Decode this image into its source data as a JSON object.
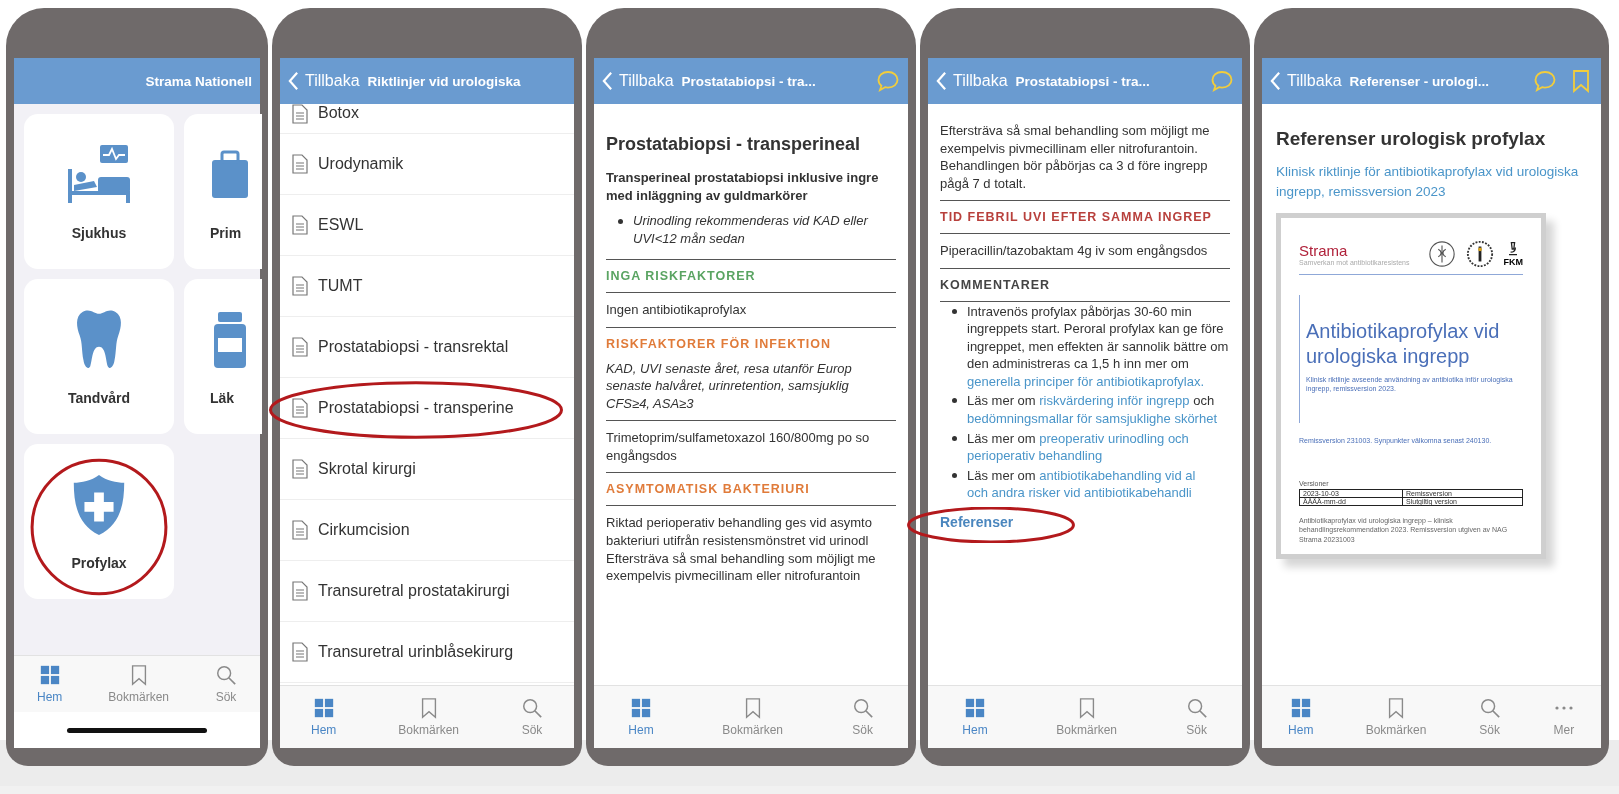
{
  "screens": [
    {
      "kind": "home",
      "header": {
        "title": "Strama Nationell"
      },
      "tiles": [
        {
          "label": "Sjukhus",
          "circled": false
        },
        {
          "label": "Prim",
          "circled": false
        },
        {
          "label": "Tandvård",
          "circled": false
        },
        {
          "label": "Läk",
          "circled": false
        },
        {
          "label": "Profylax",
          "circled": true
        }
      ],
      "tab_bar": [
        {
          "label": "Hem",
          "selected": true
        },
        {
          "label": "Bokmärken",
          "selected": false
        },
        {
          "label": "Sök",
          "selected": false
        }
      ]
    },
    {
      "kind": "list",
      "header": {
        "back": "Tillbaka",
        "title": "Riktlinjer vid urologiska"
      },
      "items": [
        {
          "label": "Botox",
          "circled": false
        },
        {
          "label": "Urodynamik",
          "circled": false
        },
        {
          "label": "ESWL",
          "circled": false
        },
        {
          "label": "TUMT",
          "circled": false
        },
        {
          "label": "Prostatabiopsi - transrektal",
          "circled": false
        },
        {
          "label": "Prostatabiopsi - transperine",
          "circled": true
        },
        {
          "label": "Skrotal kirurgi",
          "circled": false
        },
        {
          "label": "Cirkumcision",
          "circled": false
        },
        {
          "label": "Transuretral prostatakirurgi",
          "circled": false
        },
        {
          "label": "Transuretral urinblåsekirurg",
          "circled": false
        }
      ],
      "tab_bar": [
        {
          "label": "Hem",
          "selected": true
        },
        {
          "label": "Bokmärken",
          "selected": false
        },
        {
          "label": "Sök",
          "selected": false
        }
      ]
    },
    {
      "kind": "article",
      "header": {
        "back": "Tillbaka",
        "title": "Prostatabiopsi - tra..."
      },
      "blocks": [
        {
          "kind": "title",
          "text": "Prostatabiopsi - transperineal"
        },
        {
          "kind": "lead",
          "text": "Transperineal prostatabiopsi inklusive ingre med inläggning av guldmarkörer"
        },
        {
          "kind": "note",
          "text": "Urinodling rekommenderas vid KAD eller UVI<12 mån sedan"
        },
        {
          "kind": "rule"
        },
        {
          "kind": "heading",
          "text": "INGA RISKFAKTORER",
          "color": "#5aa462"
        },
        {
          "kind": "rule"
        },
        {
          "kind": "text",
          "text": "Ingen antibiotikaprofylax"
        },
        {
          "kind": "rule"
        },
        {
          "kind": "heading",
          "text": "RISKFAKTORER FÖR INFEKTION",
          "color": "#e07b3a"
        },
        {
          "kind": "emphasis",
          "text": "KAD, UVI senaste året, resa utanför Europ senaste halvåret, urinretention, samsjuklig CFS≥4, ASA≥3"
        },
        {
          "kind": "rule"
        },
        {
          "kind": "text",
          "text": "Trimetoprim/sulfametoxazol 160/800mg po so engångsdos"
        },
        {
          "kind": "rule"
        },
        {
          "kind": "heading",
          "text": "ASYMTOMATISK BAKTERIURI",
          "color": "#e07b3a"
        },
        {
          "kind": "rule"
        },
        {
          "kind": "text",
          "text": "Riktad perioperativ behandling ges vid asymto bakteriuri utifrån resistensmönstret vid urinodl Eftersträva så smal behandling som möjligt me exempelvis pivmecillinam eller nitrofurantoin"
        }
      ],
      "tab_bar": [
        {
          "label": "Hem",
          "selected": true
        },
        {
          "label": "Bokmärken",
          "selected": false
        },
        {
          "label": "Sök",
          "selected": false
        }
      ]
    },
    {
      "kind": "article",
      "header": {
        "back": "Tillbaka",
        "title": "Prostatabiopsi - tra..."
      },
      "blocks": [
        {
          "kind": "text",
          "text": "Eftersträva så smal behandling som möjligt me exempelvis pivmecillinam eller nitrofurantoin. Behandlingen bör påbörjas ca 3 d före ingrepp pågå 7 d totalt."
        },
        {
          "kind": "rule"
        },
        {
          "kind": "heading",
          "text": "TID FEBRIL UVI EFTER SAMMA INGREP",
          "color": "#b8403c"
        },
        {
          "kind": "rule"
        },
        {
          "kind": "text",
          "text": "Piperacillin/tazobaktam 4g iv som engångsdos"
        },
        {
          "kind": "rule"
        },
        {
          "kind": "heading",
          "text": "KOMMENTARER",
          "color": "#444444"
        },
        {
          "kind": "rule"
        },
        {
          "kind": "bullets",
          "items": [
            [
              {
                "kind": "text",
                "text": "Intravenös profylax påbörjas 30-60 min ingreppets start. Peroral profylax kan ge före ingreppet, men effekten är sannolik bättre om den administreras ca 1,5 h inn mer om "
              },
              {
                "kind": "link",
                "text": "generella principer för"
              },
              {
                "kind": "link",
                "text": "antibiotikaprofylax."
              }
            ],
            [
              {
                "kind": "text",
                "text": "Läs mer om "
              },
              {
                "kind": "link",
                "text": "riskvärdering inför ingrepp"
              },
              {
                "kind": "text",
                "text": " och "
              },
              {
                "kind": "link",
                "text": "bedömningsmallar för samsjuklighe"
              },
              {
                "kind": "link",
                "text": "skörhet"
              }
            ],
            [
              {
                "kind": "text",
                "text": "Läs mer om "
              },
              {
                "kind": "link",
                "text": "preoperativ urinodling och"
              },
              {
                "kind": "link",
                "text": "perioperativ behandling"
              }
            ],
            [
              {
                "kind": "text",
                "text": "Läs mer om "
              },
              {
                "kind": "link",
                "text": "antibiotikabehandling vid al"
              },
              {
                "kind": "link",
                "text": "och andra risker vid antibiotikabehandli"
              }
            ]
          ]
        },
        {
          "kind": "link",
          "text": "Referenser",
          "circled": true
        }
      ],
      "tab_bar": [
        {
          "label": "Hem",
          "selected": true
        },
        {
          "label": "Bokmärken",
          "selected": false
        },
        {
          "label": "Sök",
          "selected": false
        }
      ]
    },
    {
      "kind": "reference",
      "header": {
        "back": "Tillbaka",
        "title": "Referenser - urologi..."
      },
      "title": "Referenser urologisk profylax",
      "link": "Klinisk riktlinje för antibiotikaprofylax vid urologiska ingrepp, remissversion 2023",
      "document": {
        "brand": "Strama",
        "tagline": "Samverkan mot antibiotikaresistens",
        "logo_text": "FKM",
        "title": "Antibiotikaprofylax vid urologiska ingrepp",
        "subtitle": "Klinisk riktlinje avseende användning av antibiotika inför urologiska ingrepp, remissversion 2023.",
        "remiss": "Remissversion 231003. Synpunkter välkomna senast 240130.",
        "versions_label": "Versioner",
        "versions": [
          {
            "date": "2023-10-03",
            "label": "Remissversion"
          },
          {
            "date": "ÅÅÅÅ-mm-dd",
            "label": "Slutgiltig version"
          }
        ],
        "footer": "Antibiotikaprofylax vid urologiska ingrepp – klinisk behandlingsrekommendation 2023. Remissversion utgiven av NAG Strama 20231003"
      },
      "tab_bar": [
        {
          "label": "Hem",
          "selected": true
        },
        {
          "label": "Bokmärken",
          "selected": false
        },
        {
          "label": "Sök",
          "selected": false
        },
        {
          "label": "Mer",
          "selected": false
        }
      ]
    }
  ]
}
